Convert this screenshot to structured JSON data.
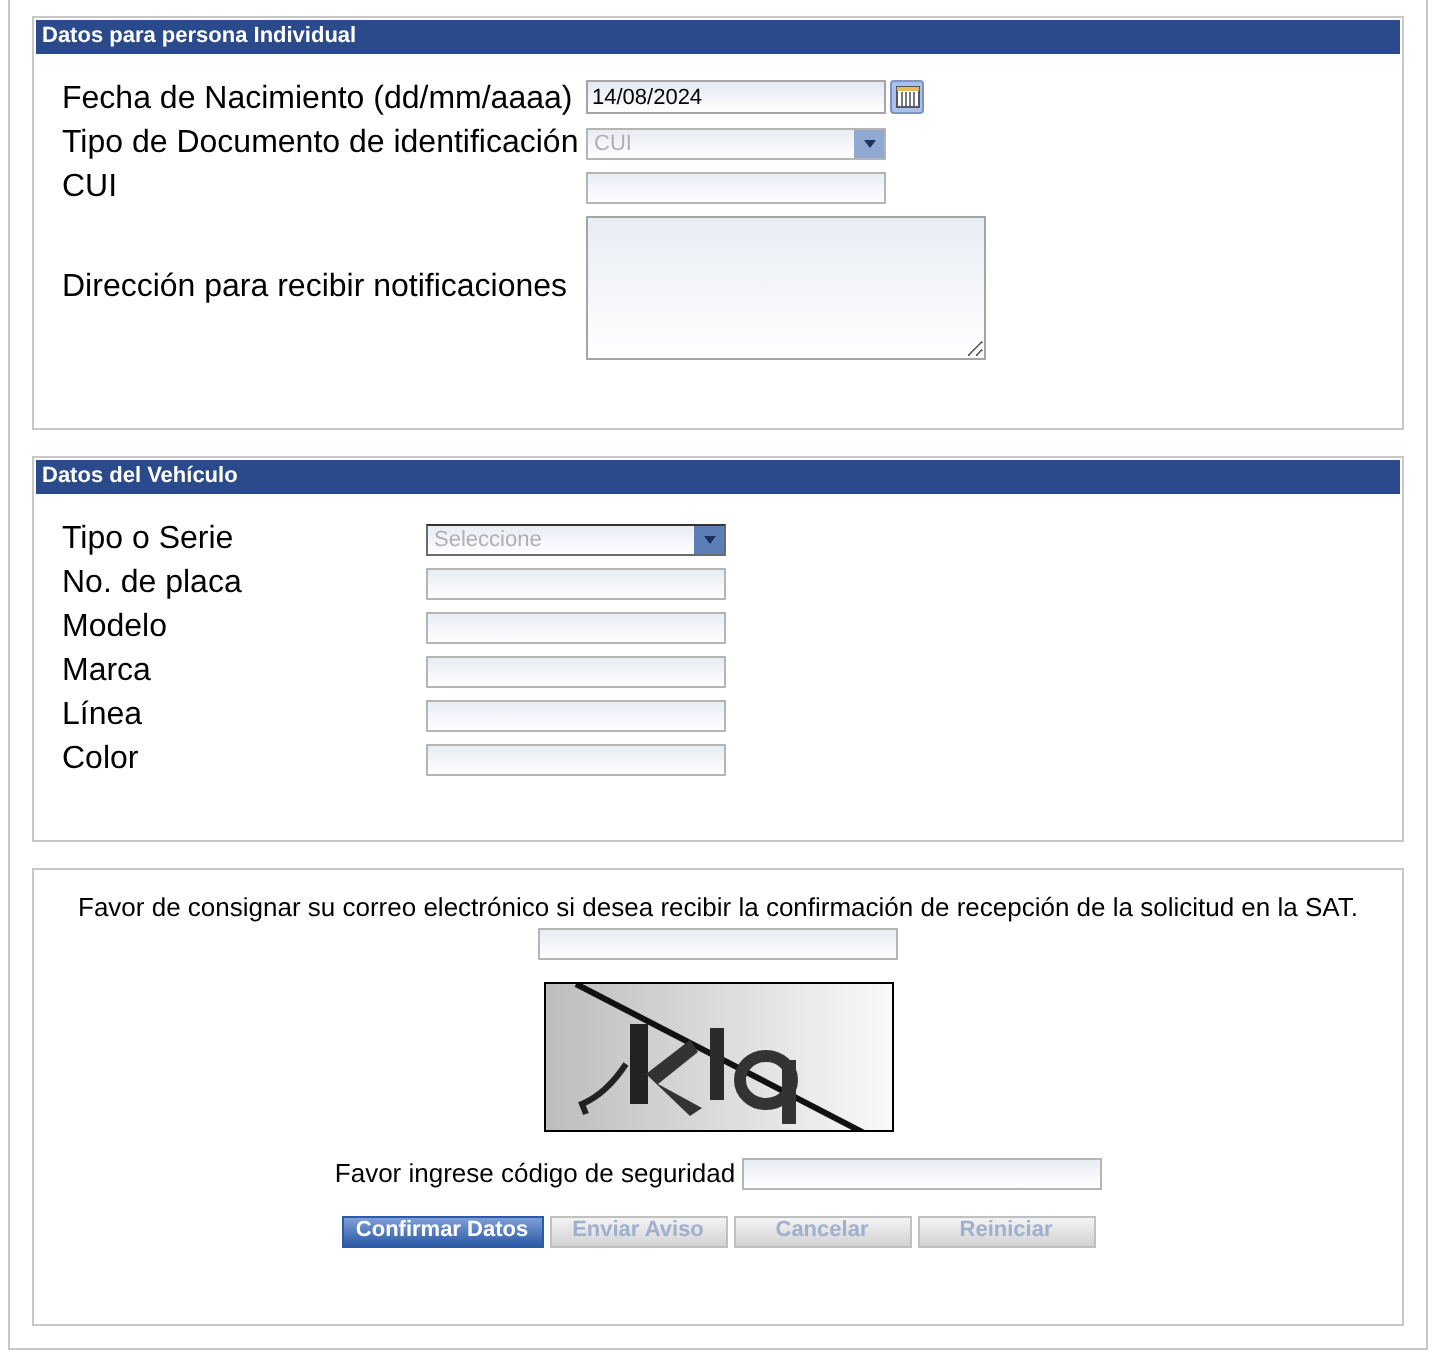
{
  "persona": {
    "title": "Datos para persona Individual",
    "fields": [
      {
        "kind": "date",
        "label": "Fecha de Nacimiento (dd/mm/aaaa)",
        "value": "14/08/2024"
      },
      {
        "kind": "select",
        "label": "Tipo de Documento de identificación",
        "value": "CUI",
        "disabled": true
      },
      {
        "kind": "text",
        "label": "CUI"
      },
      {
        "kind": "textarea",
        "label": "Dirección para recibir notificaciones"
      }
    ]
  },
  "vehiculo": {
    "title": "Datos del Vehículo",
    "fields": [
      {
        "kind": "select",
        "label": "Tipo o Serie",
        "value": "Seleccione",
        "disabled": false
      },
      {
        "kind": "text",
        "label": "No. de placa"
      },
      {
        "kind": "text",
        "label": "Modelo"
      },
      {
        "kind": "text",
        "label": "Marca"
      },
      {
        "kind": "text",
        "label": "Línea"
      },
      {
        "kind": "text",
        "label": "Color"
      }
    ]
  },
  "confirmacion": {
    "email_prompt": "Favor de consignar su correo electrónico si desea recibir la confirmación de recepción de la solicitud en la SAT.",
    "code_label": "Favor ingrese código de seguridad",
    "buttons": [
      {
        "label": "Confirmar Datos",
        "disabled": false
      },
      {
        "label": "Enviar Aviso",
        "disabled": true
      },
      {
        "label": "Cancelar",
        "disabled": true
      },
      {
        "label": "Reiniciar",
        "disabled": true
      }
    ]
  }
}
